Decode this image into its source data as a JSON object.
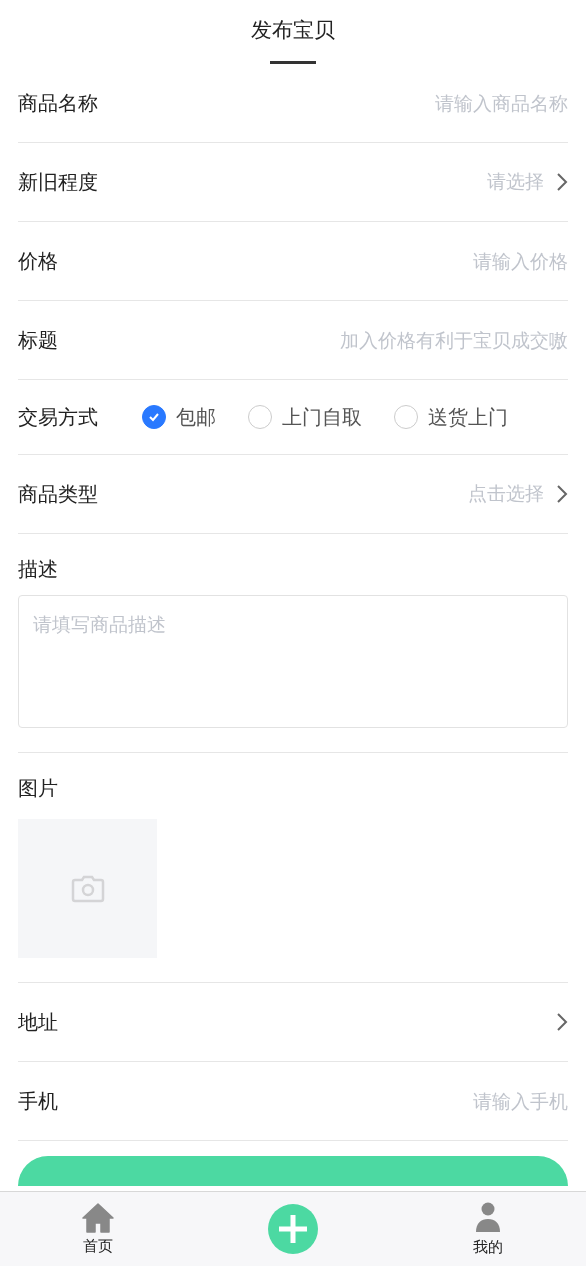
{
  "header": {
    "title": "发布宝贝"
  },
  "fields": [
    {
      "kind": "input",
      "label": "商品名称",
      "placeholder": "请输入商品名称"
    },
    {
      "kind": "select",
      "label": "新旧程度",
      "placeholder": "请选择"
    },
    {
      "kind": "input",
      "label": "价格",
      "placeholder": "请输入价格"
    },
    {
      "kind": "input",
      "label": "标题",
      "placeholder": "加入价格有利于宝贝成交嗷"
    },
    {
      "kind": "radio",
      "label": "交易方式",
      "options": [
        {
          "label": "包邮",
          "selected": true
        },
        {
          "label": "上门自取",
          "selected": false
        },
        {
          "label": "送货上门",
          "selected": false
        }
      ]
    },
    {
      "kind": "select",
      "label": "商品类型",
      "placeholder": "点击选择"
    },
    {
      "kind": "textarea",
      "label": "描述",
      "placeholder": "请填写商品描述"
    },
    {
      "kind": "image",
      "label": "图片"
    },
    {
      "kind": "select",
      "label": "地址"
    },
    {
      "kind": "input",
      "label": "手机",
      "placeholder": "请输入手机"
    }
  ],
  "tab_bar": [
    {
      "kind": "home",
      "label": "首页"
    },
    {
      "kind": "add"
    },
    {
      "kind": "profile",
      "label": "我的"
    }
  ]
}
